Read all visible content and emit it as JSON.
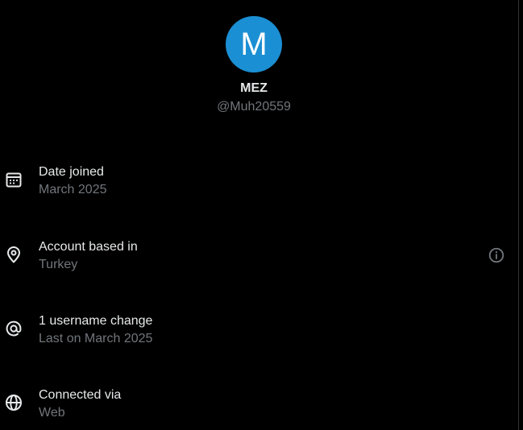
{
  "profile": {
    "avatar_letter": "M",
    "display_name": "MEZ",
    "handle": "@Muh20559"
  },
  "rows": [
    {
      "icon": "calendar-icon",
      "label": "Date joined",
      "value": "March 2025"
    },
    {
      "icon": "location-pin-icon",
      "label": "Account based in",
      "value": "Turkey"
    },
    {
      "icon": "at-sign-icon",
      "label": "1 username change",
      "value": "Last on March 2025"
    },
    {
      "icon": "globe-icon",
      "label": "Connected via",
      "value": "Web"
    }
  ],
  "colors": {
    "background": "#000000",
    "primary_text": "#e7e9ea",
    "secondary_text": "#71767b",
    "avatar_bg": "#1b8fd3"
  }
}
